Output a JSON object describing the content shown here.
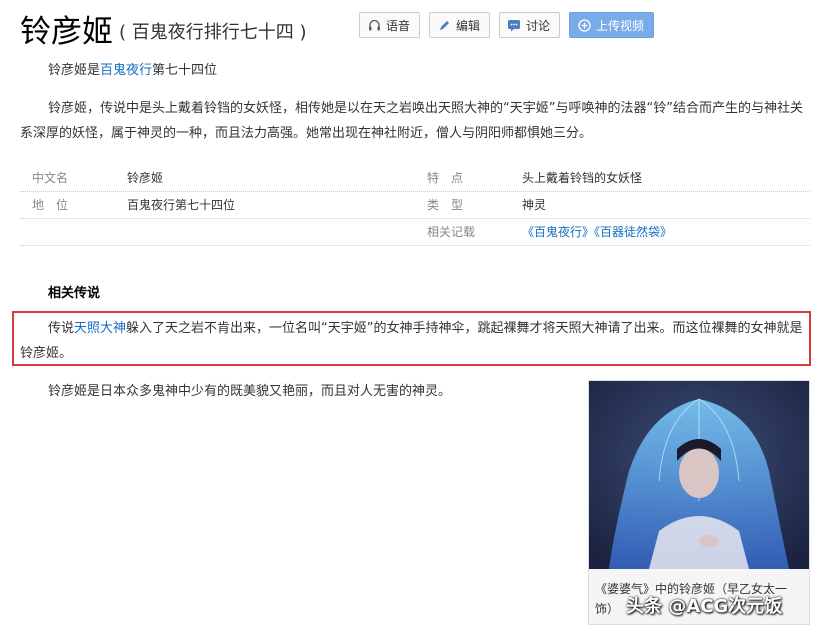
{
  "header": {
    "title": "铃彦姬",
    "subtitle": "( 百鬼夜行排行七十四 )",
    "buttons": {
      "audio": "语音",
      "edit": "编辑",
      "discuss": "讨论",
      "upload": "上传视频"
    }
  },
  "intro": {
    "prefix": "铃彦姬是",
    "link": "百鬼夜行",
    "suffix": "第七十四位"
  },
  "description": "铃彦姬，传说中是头上戴着铃铛的女妖怪，相传她是以在天之岩唤出天照大神的“天宇姬”与呼唤神的法器“铃”结合而产生的与神社关系深厚的妖怪，属于神灵的一种，而且法力高强。她常出现在神社附近，僧人与阴阳师都惧她三分。",
  "infobox": {
    "rows": [
      {
        "k1": "中文名",
        "v1": "铃彦姬",
        "k2": "特　点",
        "v2": "头上戴着铃铛的女妖怪"
      },
      {
        "k1": "地　位",
        "v1": "百鬼夜行第七十四位",
        "k2": "类　型",
        "v2": "神灵"
      },
      {
        "k1": "",
        "v1": "",
        "k2": "相关记载",
        "v2": "《百鬼夜行》《百器徒然袋》"
      }
    ]
  },
  "legend": {
    "heading": "相关传说",
    "prefix": "传说",
    "link": "天照大神",
    "rest": "躲入了天之岩不肯出来，一位名叫“天宇姬”的女神手持神伞，跳起裸舞才将天照大神请了出来。而这位裸舞的女神就是铃彦姬。"
  },
  "closing": "铃彦姬是日本众多鬼神中少有的既美貌又艳丽，而且对人无害的神灵。",
  "image": {
    "caption": "《婆婆气》中的铃彦姬（早乙女太一饰）"
  },
  "watermark": "头条 @ACG次元饭",
  "colors": {
    "link": "#136ec2",
    "upload_button": "#79abe8",
    "highlight_border": "#d63a3a"
  }
}
